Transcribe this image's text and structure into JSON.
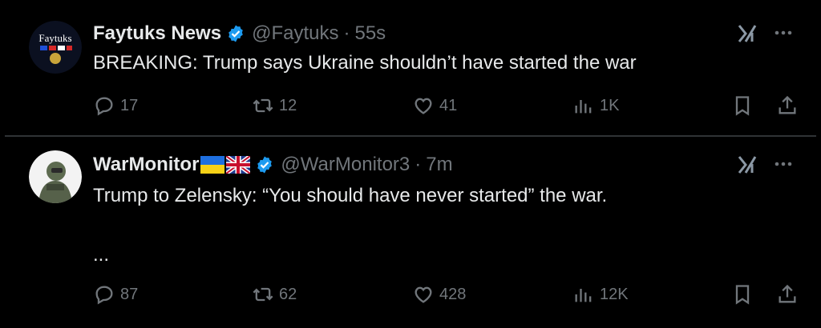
{
  "tweets": [
    {
      "name": "Faytuks News",
      "handle": "@Faytuks",
      "time": "55s",
      "avatar_text": "Faytuks",
      "text": "BREAKING: Trump says Ukraine shouldn’t have started the war",
      "more": "",
      "stats": {
        "replies": "17",
        "reposts": "12",
        "likes": "41",
        "views": "1K"
      }
    },
    {
      "name": "WarMonitor",
      "handle": "@WarMonitor3",
      "time": "7m",
      "text": "Trump to Zelensky: “You should have never started” the war.",
      "more": "...",
      "stats": {
        "replies": "87",
        "reposts": "62",
        "likes": "428",
        "views": "12K"
      }
    }
  ],
  "separator": "·",
  "colors": {
    "background": "#000000",
    "text": "#e7e9ea",
    "muted": "#71767b",
    "verified": "#1d9bf0",
    "divider": "#2f3336"
  },
  "icons": [
    "verified-badge-icon",
    "grok-icon",
    "more-icon",
    "reply-icon",
    "repost-icon",
    "like-icon",
    "views-icon",
    "bookmark-icon",
    "share-icon",
    "ukraine-flag-icon",
    "uk-flag-icon"
  ]
}
